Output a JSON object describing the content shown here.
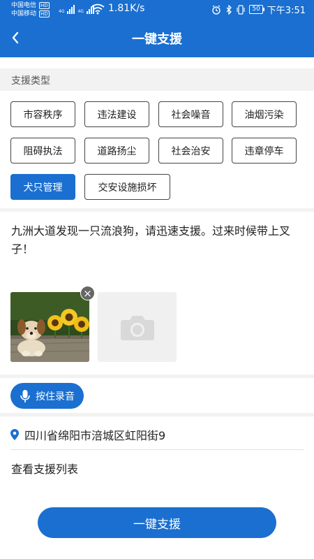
{
  "status_bar": {
    "carrier1": "中国电信",
    "carrier2": "中国移动",
    "hd": "HD",
    "net_type": "4G",
    "speed": "1.81K/s",
    "battery": "50",
    "time": "下午3:51"
  },
  "header": {
    "title": "一键支援"
  },
  "support_type": {
    "label": "支援类型",
    "options": [
      "市容秩序",
      "违法建设",
      "社会噪音",
      "油烟污染",
      "阻碍执法",
      "道路扬尘",
      "社会治安",
      "违章停车",
      "犬只管理",
      "交安设施损坏"
    ],
    "selected": "犬只管理"
  },
  "message": {
    "text": "九洲大道发现一只流浪狗，请迅速支援。过来时候带上叉子！"
  },
  "record": {
    "label": "按住录音"
  },
  "location": {
    "address": "四川省绵阳市涪城区虹阳街9"
  },
  "links": {
    "view_list": "查看支援列表"
  },
  "submit": {
    "label": "一键支援"
  },
  "colors": {
    "primary": "#1a6fd0",
    "background": "#ffffff",
    "section_bg": "#f2f2f2"
  }
}
